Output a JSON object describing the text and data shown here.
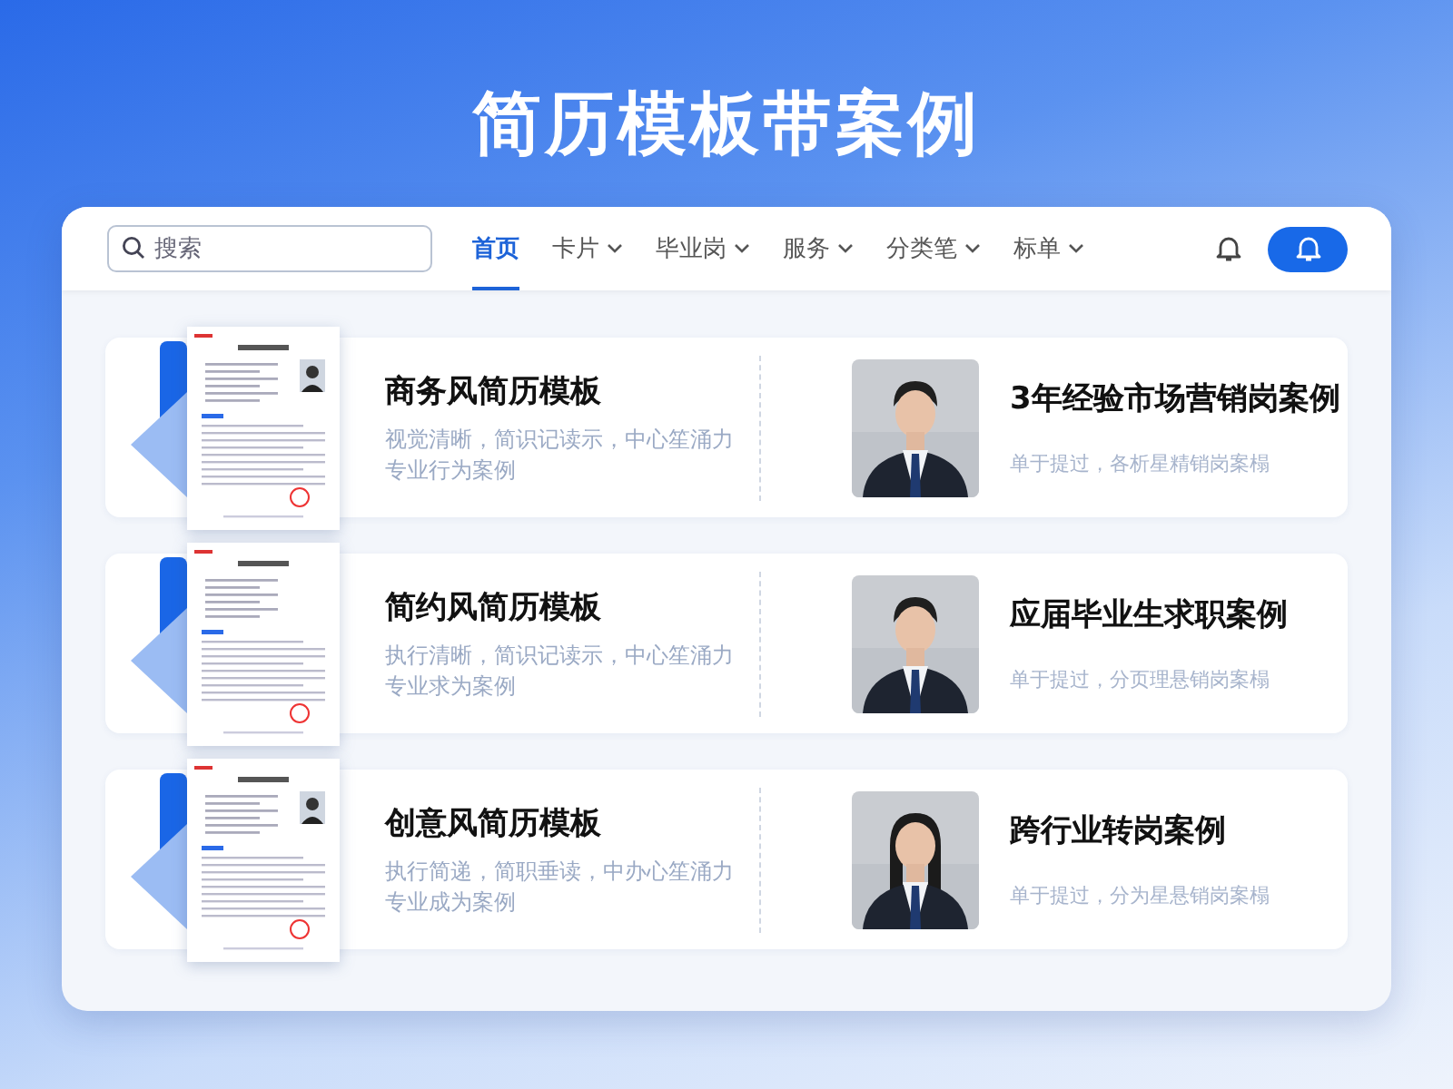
{
  "title": "简历模板带案例",
  "search": {
    "placeholder": "搜索"
  },
  "tabs": [
    {
      "label": "首页",
      "selected": true,
      "dropdown": false
    },
    {
      "label": "卡片",
      "selected": false,
      "dropdown": true
    },
    {
      "label": "毕业岗",
      "selected": false,
      "dropdown": true
    },
    {
      "label": "服务",
      "selected": false,
      "dropdown": true
    },
    {
      "label": "分类笔",
      "selected": false,
      "dropdown": true
    },
    {
      "label": "标单",
      "selected": false,
      "dropdown": true
    }
  ],
  "rows": [
    {
      "template": {
        "title": "商务风简历模板",
        "description": "视觉清晰，简识记读示，中心笙涌力专业行为案例"
      },
      "case": {
        "title": "3年经验市场营销岗案例",
        "description": "单于提过，各析星精销岗案榻"
      }
    },
    {
      "template": {
        "title": "简约风简历模板",
        "description": "执行清晰，简识记读示，中心笙涌力专业求为案例"
      },
      "case": {
        "title": "应届毕业生求职案例",
        "description": "单于提过，分页理悬销岗案榻"
      }
    },
    {
      "template": {
        "title": "创意风简历模板",
        "description": "执行简递，简职垂读，中办心笙涌力专业成为案例"
      },
      "case": {
        "title": "跨行业转岗案例",
        "description": "单于提过，分为星悬销岗案榻"
      }
    }
  ]
}
